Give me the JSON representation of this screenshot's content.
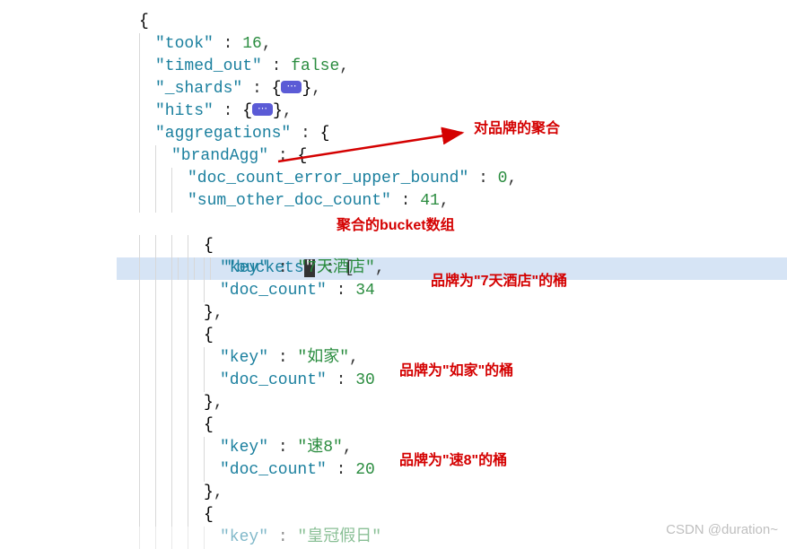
{
  "code": {
    "took_key": "\"took\"",
    "took_val": "16",
    "timed_out_key": "\"timed_out\"",
    "timed_out_val": "false",
    "shards_key": "\"_shards\"",
    "hits_key": "\"hits\"",
    "aggregations_key": "\"aggregations\"",
    "brandAgg_key": "\"brandAgg\"",
    "doc_count_error_key": "\"doc_count_error_upper_bound\"",
    "doc_count_error_val": "0",
    "sum_other_key": "\"sum_other_doc_count\"",
    "sum_other_val": "41",
    "buckets_key": "\"buckets",
    "buckets_cursor": "\"",
    "key_key": "\"key\"",
    "doc_count_key": "\"doc_count\"",
    "bucket1_key_val": "\"7天酒店\"",
    "bucket1_count_val": "34",
    "bucket2_key_val": "\"如家\"",
    "bucket2_count_val": "30",
    "bucket3_key_val": "\"速8\"",
    "bucket3_count_val": "20",
    "bucket4_partial_key": "\"key\"",
    "bucket4_partial_val_part": "\"皇冠假日\"",
    "fold_content": "⋯",
    "open_brace": "{",
    "close_brace": "}",
    "open_bracket": "[",
    "colon_sp": " : ",
    "comma": ","
  },
  "annotations": {
    "top_right": "对品牌的聚合",
    "buckets_label": "聚合的bucket数组",
    "bucket1": "品牌为\"7天酒店\"的桶",
    "bucket2": "品牌为\"如家\"的桶",
    "bucket3": "品牌为\"速8\"的桶"
  },
  "watermark": "CSDN @duration~"
}
